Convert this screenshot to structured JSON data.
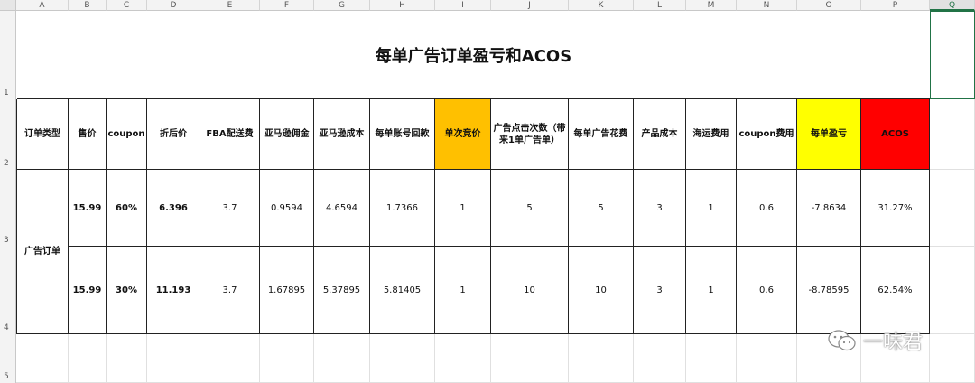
{
  "columns": [
    "A",
    "B",
    "C",
    "D",
    "E",
    "F",
    "G",
    "H",
    "I",
    "J",
    "K",
    "L",
    "M",
    "N",
    "O",
    "P",
    "Q"
  ],
  "rows": [
    "1",
    "2",
    "3",
    "4",
    "5"
  ],
  "title": "每单广告订单盈亏和ACOS",
  "headers": [
    "订单类型",
    "售价",
    "coupon",
    "折后价",
    "FBA配送费",
    "亚马逊佣金",
    "亚马逊成本",
    "每单账号回款",
    "单次竞价",
    "广告点击次数（带来1单广告单）",
    "每单广告花费",
    "产品成本",
    "海运费用",
    "coupon费用",
    "每单盈亏",
    "ACOS"
  ],
  "merged_label": "广告订单",
  "data_rows": [
    [
      "15.99",
      "60%",
      "6.396",
      "3.7",
      "0.9594",
      "4.6594",
      "1.7366",
      "1",
      "5",
      "5",
      "3",
      "1",
      "0.6",
      "-7.8634",
      "31.27%"
    ],
    [
      "15.99",
      "30%",
      "11.193",
      "3.7",
      "1.67895",
      "5.37895",
      "5.81405",
      "1",
      "10",
      "10",
      "3",
      "1",
      "0.6",
      "-8.78595",
      "62.54%"
    ]
  ],
  "colors": {
    "bid": "#ffc000",
    "profit": "#ffff00",
    "acos": "#ff0000"
  },
  "watermark": "一味君"
}
